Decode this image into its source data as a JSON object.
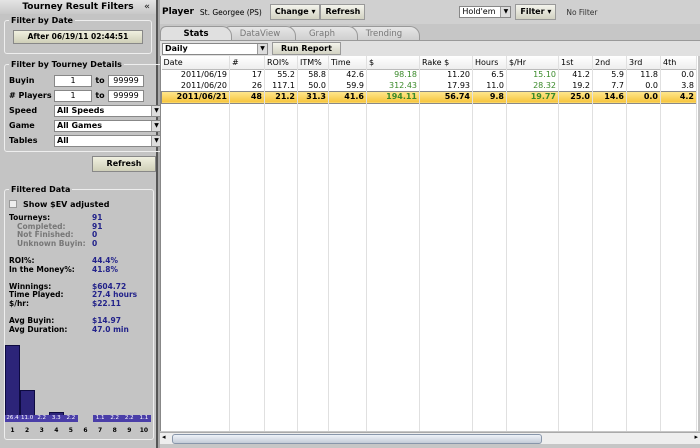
{
  "sidebar": {
    "title": "Tourney Result Filters",
    "collapse_icon": "«",
    "date_legend": "Filter by Date",
    "date_button": "After 06/19/11 02:44:51",
    "details_legend": "Filter by Tourney Details",
    "buyin_label": "Buyin",
    "buyin_min": "1",
    "buyin_max": "99999",
    "to": "to",
    "players_label": "# Players",
    "players_min": "1",
    "players_max": "99999",
    "speed_label": "Speed",
    "speed_value": "All Speeds",
    "game_label": "Game",
    "game_value": "All Games",
    "tables_label": "Tables",
    "tables_value": "All",
    "refresh": "Refresh",
    "filtered_legend": "Filtered Data",
    "show_ev": "Show $EV adjusted",
    "stats": [
      {
        "k": "Tourneys:",
        "v": "91",
        "sub": false
      },
      {
        "k": "Completed:",
        "v": "91",
        "sub": true
      },
      {
        "k": "Not Finished:",
        "v": "0",
        "sub": true
      },
      {
        "k": "Unknown Buyin:",
        "v": "0",
        "sub": true
      },
      {
        "k": "",
        "v": "",
        "sub": false
      },
      {
        "k": "ROI%:",
        "v": "44.4%",
        "sub": false
      },
      {
        "k": "In the Money%:",
        "v": "41.8%",
        "sub": false
      },
      {
        "k": "",
        "v": "",
        "sub": false
      },
      {
        "k": "Winnings:",
        "v": "$604.72",
        "sub": false
      },
      {
        "k": "Time Played:",
        "v": "27.4 hours",
        "sub": false
      },
      {
        "k": "$/hr:",
        "v": "$22.11",
        "sub": false
      },
      {
        "k": "",
        "v": "",
        "sub": false
      },
      {
        "k": "Avg Buyin:",
        "v": "$14.97",
        "sub": false
      },
      {
        "k": "Avg Duration:",
        "v": "47.0 min",
        "sub": false
      }
    ]
  },
  "histogram": {
    "positions": [
      "1",
      "2",
      "3",
      "4",
      "5",
      "6",
      "7",
      "8",
      "9",
      "10"
    ],
    "values": [
      26.4,
      11.0,
      2.2,
      3.3,
      2.2,
      0,
      1.1,
      2.2,
      2.2,
      1.1
    ],
    "labels": [
      "26.4",
      "11.0",
      "2.2",
      "3.3",
      "2.2",
      "",
      "1.1",
      "2.2",
      "2.2",
      "1.1"
    ],
    "color": "#2c2479"
  },
  "toolbar": {
    "player_label": "Player",
    "player_name": "St. Georgee (PS)",
    "change": "Change",
    "refresh": "Refresh",
    "game": "Hold'em",
    "filter": "Filter",
    "filter_status": "No Filter"
  },
  "tabs": [
    "Stats",
    "DataView",
    "Graph",
    "Trending"
  ],
  "report": {
    "period": "Daily",
    "run": "Run Report"
  },
  "table": {
    "headers": [
      "Date",
      "#",
      "ROI%",
      "ITM%",
      "Time",
      "$",
      "Rake $",
      "Hours",
      "$/Hr",
      "1st",
      "2nd",
      "3rd",
      "4th"
    ],
    "rows": [
      [
        "2011/06/19",
        "17",
        "55.2",
        "58.8",
        "42.6",
        "98.18",
        "11.20",
        "6.5",
        "15.10",
        "41.2",
        "5.9",
        "11.8",
        "0.0"
      ],
      [
        "2011/06/20",
        "26",
        "117.1",
        "50.0",
        "59.9",
        "312.43",
        "17.93",
        "11.0",
        "28.32",
        "19.2",
        "7.7",
        "0.0",
        "3.8"
      ],
      [
        "2011/06/21",
        "48",
        "21.2",
        "31.3",
        "41.6",
        "194.11",
        "56.74",
        "9.8",
        "19.77",
        "25.0",
        "14.6",
        "0.0",
        "4.2"
      ]
    ],
    "selected_row": 2
  }
}
